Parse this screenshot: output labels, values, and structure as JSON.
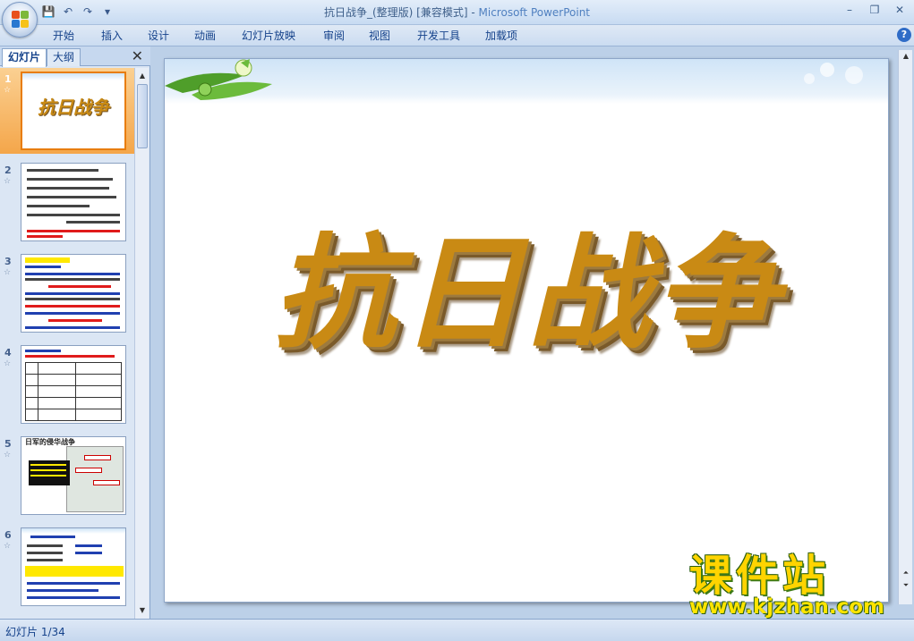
{
  "window": {
    "title": "抗日战争_(整理版) [兼容模式] - Microsoft PowerPoint",
    "doc_title": "抗日战争_(整理版) [兼容模式]",
    "app_name": "Microsoft PowerPoint"
  },
  "qat": {
    "save_icon": "save-icon",
    "undo_icon": "undo-icon",
    "redo_icon": "redo-icon",
    "more_icon": "dropdown-icon"
  },
  "ribbon": {
    "tabs": [
      "开始",
      "插入",
      "设计",
      "动画",
      "幻灯片放映",
      "审阅",
      "视图",
      "开发工具",
      "加载项"
    ]
  },
  "left_pane": {
    "tabs": [
      "幻灯片",
      "大纲"
    ],
    "active_tab": "幻灯片",
    "slides": [
      {
        "num": "1",
        "title": "抗日战争",
        "active": true
      },
      {
        "num": "2"
      },
      {
        "num": "3"
      },
      {
        "num": "4"
      },
      {
        "num": "5",
        "title": "日军的侵华战争"
      },
      {
        "num": "6"
      }
    ]
  },
  "slide": {
    "title": "抗日战争"
  },
  "watermark": {
    "brand": "课件站",
    "url": "www.kjzhan.com"
  },
  "status": {
    "slide_indicator": "幻灯片 1/34"
  },
  "colors": {
    "accent": "#f4a64a",
    "ribbon_text": "#15428b",
    "title_gold": "#c98a14"
  }
}
